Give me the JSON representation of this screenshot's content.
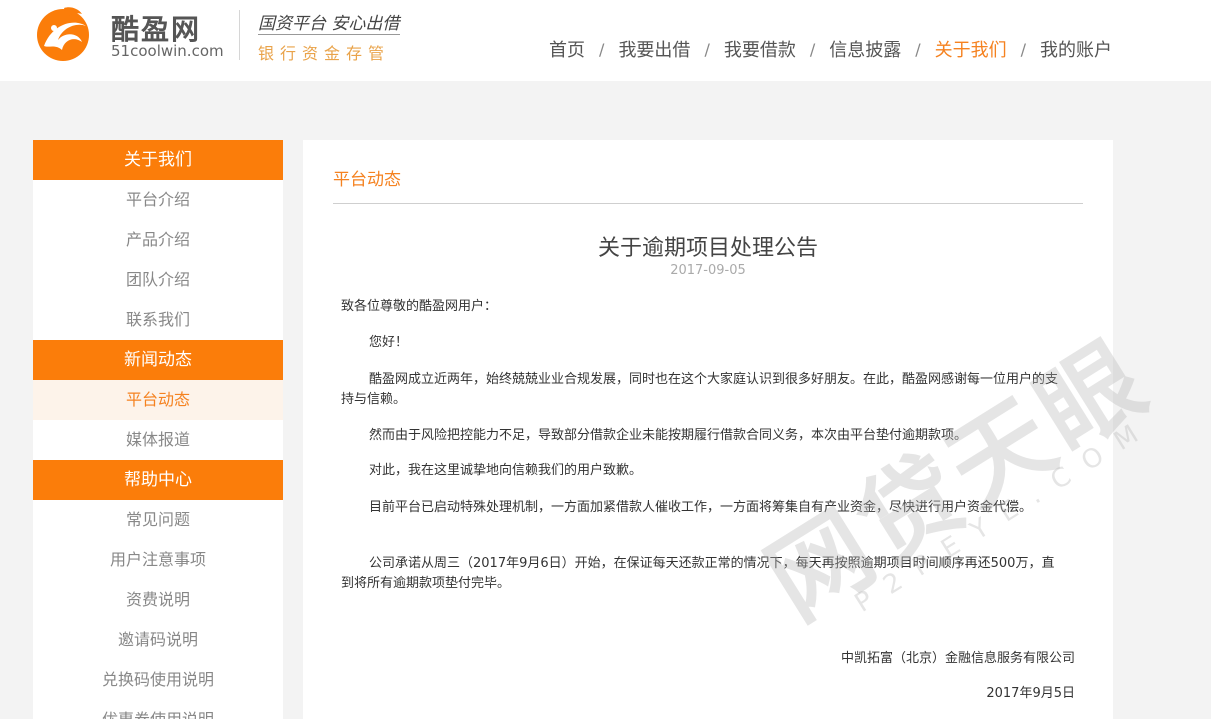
{
  "header": {
    "brand_name": "酷盈网",
    "brand_domain": "51coolwin.com",
    "slogan_top": "国资平台 安心出借",
    "slogan_bottom": "银行资金存管",
    "nav": [
      {
        "label": "首页",
        "active": false
      },
      {
        "label": "我要出借",
        "active": false
      },
      {
        "label": "我要借款",
        "active": false
      },
      {
        "label": "信息披露",
        "active": false
      },
      {
        "label": "关于我们",
        "active": true
      },
      {
        "label": "我的账户",
        "active": false
      }
    ],
    "nav_separator": "/",
    "brand_color": "#f58220"
  },
  "sidebar": {
    "groups": [
      {
        "title": "关于我们",
        "items": [
          "平台介绍",
          "产品介绍",
          "团队介绍",
          "联系我们"
        ]
      },
      {
        "title": "新闻动态",
        "items": [
          "平台动态",
          "媒体报道"
        ]
      },
      {
        "title": "帮助中心",
        "items": [
          "常见问题",
          "用户注意事项",
          "资费说明",
          "邀请码说明",
          "兑换码使用说明",
          "优惠券使用说明"
        ]
      }
    ],
    "active_item": "平台动态",
    "header_color": "#fb7d0a"
  },
  "article": {
    "section": "平台动态",
    "title": "关于逾期项目处理公告",
    "date": "2017-09-05",
    "greeting": "致各位尊敬的酷盈网用户：",
    "hello": "您好！",
    "p1": "酷盈网成立近两年，始终兢兢业业合规发展，同时也在这个大家庭认识到很多好朋友。在此，酷盈网感谢每一位用户的支持与信赖。",
    "p2": "然而由于风险把控能力不足，导致部分借款企业未能按期履行借款合同义务，本次由平台垫付逾期款项。",
    "p3": "对此，我在这里诚挚地向信赖我们的用户致歉。",
    "p4": "目前平台已启动特殊处理机制，一方面加紧借款人催收工作，一方面将筹集自有产业资金，尽快进行用户资金代偿。",
    "p5": "公司承诺从周三（2017年9月6日）开始，在保证每天还款正常的情况下，每天再按照逾期项目时间顺序再还500万，直到将所有逾期款项垫付完毕。",
    "signature_company": "中凯拓富（北京）金融信息服务有限公司",
    "signature_date": "2017年9月5日"
  },
  "watermark": {
    "main": "网贷天眼",
    "sub": "P2PEYE.COM"
  }
}
